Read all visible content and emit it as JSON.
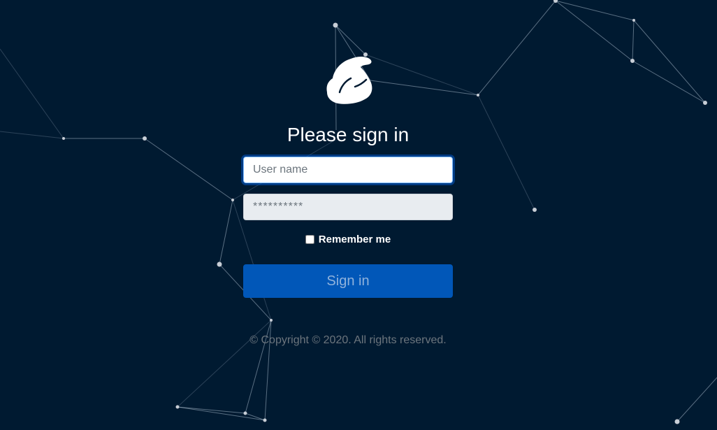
{
  "login": {
    "title": "Please sign in",
    "username_placeholder": "User name",
    "password_placeholder": "**********",
    "remember_label": "Remember me",
    "remember_checked": false,
    "submit_label": "Sign in",
    "copyright": "© Copyright © 2020. All rights reserved."
  },
  "theme": {
    "background": "#001a31",
    "accent": "#0157b8",
    "logo_color": "#ffffff"
  },
  "icons": {
    "logo": "smurf-hat-logo",
    "background": "particle-network"
  }
}
